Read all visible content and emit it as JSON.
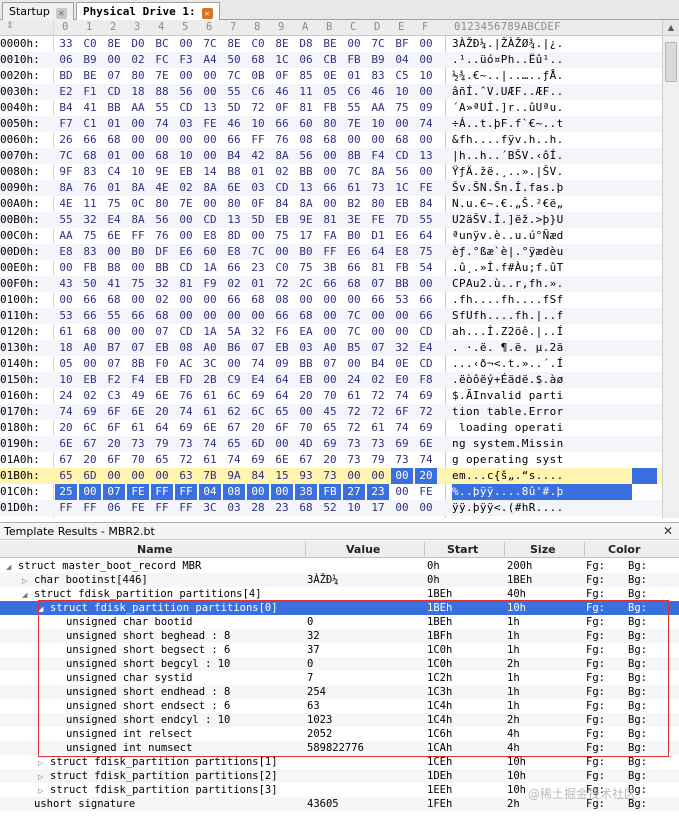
{
  "tabs": [
    {
      "label": "Startup"
    },
    {
      "label": "Physical Drive 1:"
    }
  ],
  "hex": {
    "header": {
      "cols": [
        "0",
        "1",
        "2",
        "3",
        "4",
        "5",
        "6",
        "7",
        "8",
        "9",
        "A",
        "B",
        "C",
        "D",
        "E",
        "F"
      ],
      "ascii": "0123456789ABCDEF"
    },
    "rows": [
      {
        "addr": "0000h:",
        "bytes": [
          "33",
          "C0",
          "8E",
          "D0",
          "BC",
          "00",
          "7C",
          "8E",
          "C0",
          "8E",
          "D8",
          "BE",
          "00",
          "7C",
          "BF",
          "00"
        ],
        "ascii": "3ÀŽÐ¼.|ŽÀŽØ¾.|¿."
      },
      {
        "addr": "0010h:",
        "bytes": [
          "06",
          "B9",
          "00",
          "02",
          "FC",
          "F3",
          "A4",
          "50",
          "68",
          "1C",
          "06",
          "CB",
          "FB",
          "B9",
          "04",
          "00"
        ],
        "ascii": ".¹..üó¤Ph..Ëû¹.."
      },
      {
        "addr": "0020h:",
        "bytes": [
          "BD",
          "BE",
          "07",
          "80",
          "7E",
          "00",
          "00",
          "7C",
          "0B",
          "0F",
          "85",
          "0E",
          "01",
          "83",
          "C5",
          "10"
        ],
        "ascii": "½¾.€~..|..…..ƒÅ."
      },
      {
        "addr": "0030h:",
        "bytes": [
          "E2",
          "F1",
          "CD",
          "18",
          "88",
          "56",
          "00",
          "55",
          "C6",
          "46",
          "11",
          "05",
          "C6",
          "46",
          "10",
          "00"
        ],
        "ascii": "âñÍ.ˆV.UÆF..ÆF.."
      },
      {
        "addr": "0040h:",
        "bytes": [
          "B4",
          "41",
          "BB",
          "AA",
          "55",
          "CD",
          "13",
          "5D",
          "72",
          "0F",
          "81",
          "FB",
          "55",
          "AA",
          "75",
          "09"
        ],
        "ascii": "´A»ªUÍ.]r..ûUªu."
      },
      {
        "addr": "0050h:",
        "bytes": [
          "F7",
          "C1",
          "01",
          "00",
          "74",
          "03",
          "FE",
          "46",
          "10",
          "66",
          "60",
          "80",
          "7E",
          "10",
          "00",
          "74"
        ],
        "ascii": "÷Á..t.þF.f`€~..t"
      },
      {
        "addr": "0060h:",
        "bytes": [
          "26",
          "66",
          "68",
          "00",
          "00",
          "00",
          "00",
          "66",
          "FF",
          "76",
          "08",
          "68",
          "00",
          "00",
          "68",
          "00"
        ],
        "ascii": "&fh....fÿv.h..h."
      },
      {
        "addr": "0070h:",
        "bytes": [
          "7C",
          "68",
          "01",
          "00",
          "68",
          "10",
          "00",
          "B4",
          "42",
          "8A",
          "56",
          "00",
          "8B",
          "F4",
          "CD",
          "13"
        ],
        "ascii": "|h..h..´BŠV.‹ôÍ."
      },
      {
        "addr": "0080h:",
        "bytes": [
          "9F",
          "83",
          "C4",
          "10",
          "9E",
          "EB",
          "14",
          "B8",
          "01",
          "02",
          "BB",
          "00",
          "7C",
          "8A",
          "56",
          "00"
        ],
        "ascii": "ŸƒÄ.žë.¸..».|ŠV."
      },
      {
        "addr": "0090h:",
        "bytes": [
          "8A",
          "76",
          "01",
          "8A",
          "4E",
          "02",
          "8A",
          "6E",
          "03",
          "CD",
          "13",
          "66",
          "61",
          "73",
          "1C",
          "FE"
        ],
        "ascii": "Šv.ŠN.Šn.Í.fas.þ"
      },
      {
        "addr": "00A0h:",
        "bytes": [
          "4E",
          "11",
          "75",
          "0C",
          "80",
          "7E",
          "00",
          "80",
          "0F",
          "84",
          "8A",
          "00",
          "B2",
          "80",
          "EB",
          "84"
        ],
        "ascii": "N.u.€~.€.„Š.²€ë„"
      },
      {
        "addr": "00B0h:",
        "bytes": [
          "55",
          "32",
          "E4",
          "8A",
          "56",
          "00",
          "CD",
          "13",
          "5D",
          "EB",
          "9E",
          "81",
          "3E",
          "FE",
          "7D",
          "55"
        ],
        "ascii": "U2äŠV.Í.]ëž.>þ}U"
      },
      {
        "addr": "00C0h:",
        "bytes": [
          "AA",
          "75",
          "6E",
          "FF",
          "76",
          "00",
          "E8",
          "8D",
          "00",
          "75",
          "17",
          "FA",
          "B0",
          "D1",
          "E6",
          "64"
        ],
        "ascii": "ªunÿv.è..u.ú°Ñæd"
      },
      {
        "addr": "00D0h:",
        "bytes": [
          "E8",
          "83",
          "00",
          "B0",
          "DF",
          "E6",
          "60",
          "E8",
          "7C",
          "00",
          "B0",
          "FF",
          "E6",
          "64",
          "E8",
          "75"
        ],
        "ascii": "èƒ.°ßæ`è|.°ÿædèu"
      },
      {
        "addr": "00E0h:",
        "bytes": [
          "00",
          "FB",
          "B8",
          "00",
          "BB",
          "CD",
          "1A",
          "66",
          "23",
          "C0",
          "75",
          "3B",
          "66",
          "81",
          "FB",
          "54"
        ],
        "ascii": ".û¸.»Í.f#Àu;f.ûT"
      },
      {
        "addr": "00F0h:",
        "bytes": [
          "43",
          "50",
          "41",
          "75",
          "32",
          "81",
          "F9",
          "02",
          "01",
          "72",
          "2C",
          "66",
          "68",
          "07",
          "BB",
          "00"
        ],
        "ascii": "CPAu2.ù..r,fh.»."
      },
      {
        "addr": "0100h:",
        "bytes": [
          "00",
          "66",
          "68",
          "00",
          "02",
          "00",
          "00",
          "66",
          "68",
          "08",
          "00",
          "00",
          "00",
          "66",
          "53",
          "66"
        ],
        "ascii": ".fh....fh....fSf"
      },
      {
        "addr": "0110h:",
        "bytes": [
          "53",
          "66",
          "55",
          "66",
          "68",
          "00",
          "00",
          "00",
          "00",
          "66",
          "68",
          "00",
          "7C",
          "00",
          "00",
          "66"
        ],
        "ascii": "SfUfh....fh.|..f"
      },
      {
        "addr": "0120h:",
        "bytes": [
          "61",
          "68",
          "00",
          "00",
          "07",
          "CD",
          "1A",
          "5A",
          "32",
          "F6",
          "EA",
          "00",
          "7C",
          "00",
          "00",
          "CD"
        ],
        "ascii": "ah...Í.Z2öê.|..Í"
      },
      {
        "addr": "0130h:",
        "bytes": [
          "18",
          "A0",
          "B7",
          "07",
          "EB",
          "08",
          "A0",
          "B6",
          "07",
          "EB",
          "03",
          "A0",
          "B5",
          "07",
          "32",
          "E4"
        ],
        "ascii": ". ·.ë. ¶.ë. µ.2ä"
      },
      {
        "addr": "0140h:",
        "bytes": [
          "05",
          "00",
          "07",
          "8B",
          "F0",
          "AC",
          "3C",
          "00",
          "74",
          "09",
          "BB",
          "07",
          "00",
          "B4",
          "0E",
          "CD"
        ],
        "ascii": "...‹ð¬<.t.»..´.Í"
      },
      {
        "addr": "0150h:",
        "bytes": [
          "10",
          "EB",
          "F2",
          "F4",
          "EB",
          "FD",
          "2B",
          "C9",
          "E4",
          "64",
          "EB",
          "00",
          "24",
          "02",
          "E0",
          "F8"
        ],
        "ascii": ".ëòôëý+Éädë.$.àø"
      },
      {
        "addr": "0160h:",
        "bytes": [
          "24",
          "02",
          "C3",
          "49",
          "6E",
          "76",
          "61",
          "6C",
          "69",
          "64",
          "20",
          "70",
          "61",
          "72",
          "74",
          "69"
        ],
        "ascii": "$.ÃInvalid parti"
      },
      {
        "addr": "0170h:",
        "bytes": [
          "74",
          "69",
          "6F",
          "6E",
          "20",
          "74",
          "61",
          "62",
          "6C",
          "65",
          "00",
          "45",
          "72",
          "72",
          "6F",
          "72"
        ],
        "ascii": "tion table.Error"
      },
      {
        "addr": "0180h:",
        "bytes": [
          "20",
          "6C",
          "6F",
          "61",
          "64",
          "69",
          "6E",
          "67",
          "20",
          "6F",
          "70",
          "65",
          "72",
          "61",
          "74",
          "69"
        ],
        "ascii": " loading operati"
      },
      {
        "addr": "0190h:",
        "bytes": [
          "6E",
          "67",
          "20",
          "73",
          "79",
          "73",
          "74",
          "65",
          "6D",
          "00",
          "4D",
          "69",
          "73",
          "73",
          "69",
          "6E"
        ],
        "ascii": "ng system.Missin"
      },
      {
        "addr": "01A0h:",
        "bytes": [
          "67",
          "20",
          "6F",
          "70",
          "65",
          "72",
          "61",
          "74",
          "69",
          "6E",
          "67",
          "20",
          "73",
          "79",
          "73",
          "74"
        ],
        "ascii": "g operating syst"
      },
      {
        "addr": "01B0h:",
        "bytes": [
          "65",
          "6D",
          "00",
          "00",
          "00",
          "63",
          "7B",
          "9A",
          "84",
          "15",
          "93",
          "73",
          "00",
          "00",
          "00",
          "20"
        ],
        "ascii": "em...c{š„.“s...."
      },
      {
        "addr": "01C0h:",
        "bytes": [
          "25",
          "00",
          "07",
          "FE",
          "FF",
          "FF",
          "04",
          "08",
          "00",
          "00",
          "38",
          "FB",
          "27",
          "23",
          "00",
          "FE"
        ],
        "ascii": "%..þÿÿ....8û'#.þ"
      },
      {
        "addr": "01D0h:",
        "bytes": [
          "FF",
          "FF",
          "06",
          "FE",
          "FF",
          "FF",
          "3C",
          "03",
          "28",
          "23",
          "68",
          "52",
          "10",
          "17",
          "00",
          "00"
        ],
        "ascii": "ÿÿ.þÿÿ<.(#hR...."
      }
    ]
  },
  "template": {
    "title": "Template Results - MBR2.bt",
    "columns": {
      "name": "Name",
      "value": "Value",
      "start": "Start",
      "size": "Size",
      "color": "Color"
    },
    "rows": [
      {
        "toggle": "◢",
        "name": "struct master_boot_record MBR",
        "value": "",
        "start": "0h",
        "size": "200h",
        "fg": "Fg:",
        "bg": "Bg:"
      },
      {
        "toggle": "▷",
        "name": "char bootinst[446]",
        "value": "3ÀŽÐ¼",
        "start": "0h",
        "size": "1BEh",
        "fg": "Fg:",
        "bg": "Bg:"
      },
      {
        "toggle": "◢",
        "name": "struct fdisk_partition partitions[4]",
        "value": "",
        "start": "1BEh",
        "size": "40h",
        "fg": "Fg:",
        "bg": "Bg:"
      },
      {
        "toggle": "◢",
        "name": "struct fdisk_partition partitions[0]",
        "value": "",
        "start": "1BEh",
        "size": "10h",
        "fg": "Fg:",
        "bg": "Bg:"
      },
      {
        "toggle": "",
        "name": "unsigned char bootid",
        "value": "0",
        "start": "1BEh",
        "size": "1h",
        "fg": "Fg:",
        "bg": "Bg:"
      },
      {
        "toggle": "",
        "name": "unsigned short beghead : 8",
        "value": "32",
        "start": "1BFh",
        "size": "1h",
        "fg": "Fg:",
        "bg": "Bg:"
      },
      {
        "toggle": "",
        "name": "unsigned short begsect : 6",
        "value": "37",
        "start": "1C0h",
        "size": "1h",
        "fg": "Fg:",
        "bg": "Bg:"
      },
      {
        "toggle": "",
        "name": "unsigned short begcyl : 10",
        "value": "0",
        "start": "1C0h",
        "size": "2h",
        "fg": "Fg:",
        "bg": "Bg:"
      },
      {
        "toggle": "",
        "name": "unsigned char systid",
        "value": "7",
        "start": "1C2h",
        "size": "1h",
        "fg": "Fg:",
        "bg": "Bg:"
      },
      {
        "toggle": "",
        "name": "unsigned short endhead : 8",
        "value": "254",
        "start": "1C3h",
        "size": "1h",
        "fg": "Fg:",
        "bg": "Bg:"
      },
      {
        "toggle": "",
        "name": "unsigned short endsect : 6",
        "value": "63",
        "start": "1C4h",
        "size": "1h",
        "fg": "Fg:",
        "bg": "Bg:"
      },
      {
        "toggle": "",
        "name": "unsigned short endcyl : 10",
        "value": "1023",
        "start": "1C4h",
        "size": "2h",
        "fg": "Fg:",
        "bg": "Bg:"
      },
      {
        "toggle": "",
        "name": "unsigned int relsect",
        "value": "2052",
        "start": "1C6h",
        "size": "4h",
        "fg": "Fg:",
        "bg": "Bg:"
      },
      {
        "toggle": "",
        "name": "unsigned int numsect",
        "value": "589822776",
        "start": "1CAh",
        "size": "4h",
        "fg": "Fg:",
        "bg": "Bg:"
      },
      {
        "toggle": "▷",
        "name": "struct fdisk_partition partitions[1]",
        "value": "",
        "start": "1CEh",
        "size": "10h",
        "fg": "Fg:",
        "bg": "Bg:"
      },
      {
        "toggle": "▷",
        "name": "struct fdisk_partition partitions[2]",
        "value": "",
        "start": "1DEh",
        "size": "10h",
        "fg": "Fg:",
        "bg": "Bg:"
      },
      {
        "toggle": "▷",
        "name": "struct fdisk_partition partitions[3]",
        "value": "",
        "start": "1EEh",
        "size": "10h",
        "fg": "Fg:",
        "bg": "Bg:"
      },
      {
        "toggle": "",
        "name": "ushort signature",
        "value": "43605",
        "start": "1FEh",
        "size": "2h",
        "fg": "Fg:",
        "bg": "Bg:"
      }
    ]
  },
  "watermark": "@稀土掘金技术社区",
  "colors": {
    "selection": "#3a6fe0",
    "highlight": "#fff4b0",
    "annotation_box": "#e03030"
  }
}
